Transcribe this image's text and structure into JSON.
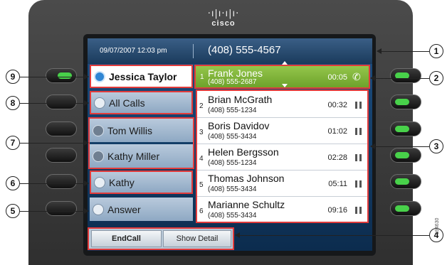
{
  "brand": {
    "bars": "·ı|ı·ı|ı·",
    "name": "cisco"
  },
  "header": {
    "datetime": "09/07/2007 12:03 pm",
    "line_number": "(408) 555-4567"
  },
  "line_keys": [
    {
      "label": "Jessica Taylor",
      "icon": "phone-blue-icon"
    },
    {
      "label": "All Calls",
      "icon": "all-calls-icon"
    },
    {
      "label": "Tom Willis",
      "icon": "handset-icon"
    },
    {
      "label": "Kathy Miller",
      "icon": "handset-icon"
    },
    {
      "label": "Kathy",
      "icon": "speed-dial-icon"
    },
    {
      "label": "Answer",
      "icon": "answer-icon"
    }
  ],
  "calls": [
    {
      "index": "1",
      "name": "Frank Jones",
      "number": "(408) 555-2687",
      "time": "00:05",
      "state": "active"
    },
    {
      "index": "2",
      "name": "Brian McGrath",
      "number": "(408) 555-1234",
      "time": "00:32",
      "state": "hold"
    },
    {
      "index": "3",
      "name": "Boris Davidov",
      "number": "(408) 555-3434",
      "time": "01:02",
      "state": "hold"
    },
    {
      "index": "4",
      "name": "Helen Bergsson",
      "number": "(408) 555-1234",
      "time": "02:28",
      "state": "hold"
    },
    {
      "index": "5",
      "name": "Thomas Johnson",
      "number": "(408) 555-3434",
      "time": "05:11",
      "state": "hold"
    },
    {
      "index": "6",
      "name": "Marianne Schultz",
      "number": "(408) 555-3434",
      "time": "09:16",
      "state": "hold"
    }
  ],
  "softkeys": {
    "end_call": "EndCall",
    "show_detail": "Show Detail"
  },
  "callouts": [
    "1",
    "2",
    "3",
    "4",
    "5",
    "6",
    "7",
    "8",
    "9"
  ],
  "figure_id": "194630",
  "colors": {
    "active_call": "#7fb33a",
    "callout_outline": "#e23b3b",
    "led": "#48d14a",
    "screen": "#123f6b"
  }
}
